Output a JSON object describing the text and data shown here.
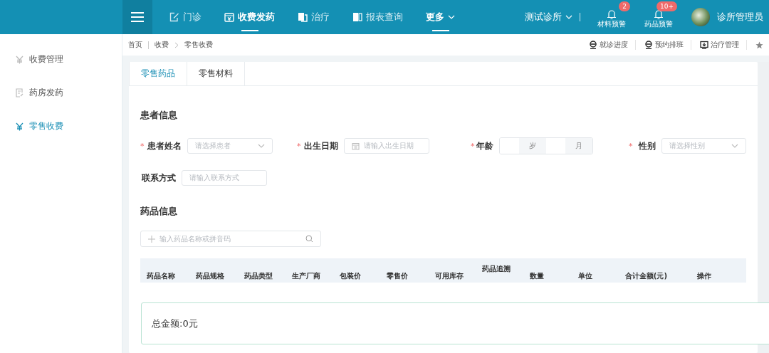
{
  "nav": {
    "items": [
      {
        "label": "门诊",
        "selected": false,
        "kind": "link"
      },
      {
        "label": "收费发药",
        "selected": true,
        "kind": "link"
      },
      {
        "label": "治疗",
        "selected": false,
        "kind": "link"
      },
      {
        "label": "报表查询",
        "selected": false,
        "kind": "link"
      },
      {
        "label": "更多",
        "selected": true,
        "kind": "dropdown"
      }
    ],
    "clinic": "测试诊所",
    "alerts": [
      {
        "label": "材料预警",
        "badge": "2"
      },
      {
        "label": "药品预警",
        "badge": "10+"
      }
    ],
    "user": "诊所管理员"
  },
  "sidebar": {
    "items": [
      {
        "label": "收费管理",
        "selected": false
      },
      {
        "label": "药房发药",
        "selected": false
      },
      {
        "label": "零售收费",
        "selected": true
      }
    ]
  },
  "breadcrumb": [
    "首页",
    "收费",
    "零售收费"
  ],
  "shortcuts": [
    {
      "label": "就诊进度"
    },
    {
      "label": "预约排班"
    },
    {
      "label": "治疗管理"
    }
  ],
  "tabs": [
    {
      "label": "零售药品",
      "selected": true
    },
    {
      "label": "零售材料",
      "selected": false
    }
  ],
  "patient": {
    "title": "患者信息",
    "fields": [
      {
        "label": "患者姓名",
        "required_mark": "*",
        "kind": "select",
        "placeholder": "请选择患者"
      },
      {
        "label": "出生日期",
        "required_mark": "*",
        "kind": "date",
        "placeholder": "请输入出生日期"
      },
      {
        "label": "年龄",
        "required_mark": "*",
        "kind": "age",
        "units": [
          "岁",
          "月"
        ]
      },
      {
        "label": "性别",
        "required_mark": "*",
        "kind": "select",
        "placeholder": "请选择性别"
      },
      {
        "label": "联系方式",
        "kind": "input",
        "placeholder": "请输入联系方式"
      }
    ]
  },
  "drugs": {
    "title": "药品信息",
    "search": {
      "placeholder": "输入药品名称或拼音码"
    },
    "columns": [
      "药品名称",
      "药品规格",
      "药品类型",
      "生产厂商",
      "包装价",
      "零售价",
      "可用库存",
      "药品追溯",
      "数量",
      "单位",
      "合计金额(元)",
      "操作"
    ],
    "total": "总金额:0元"
  }
}
